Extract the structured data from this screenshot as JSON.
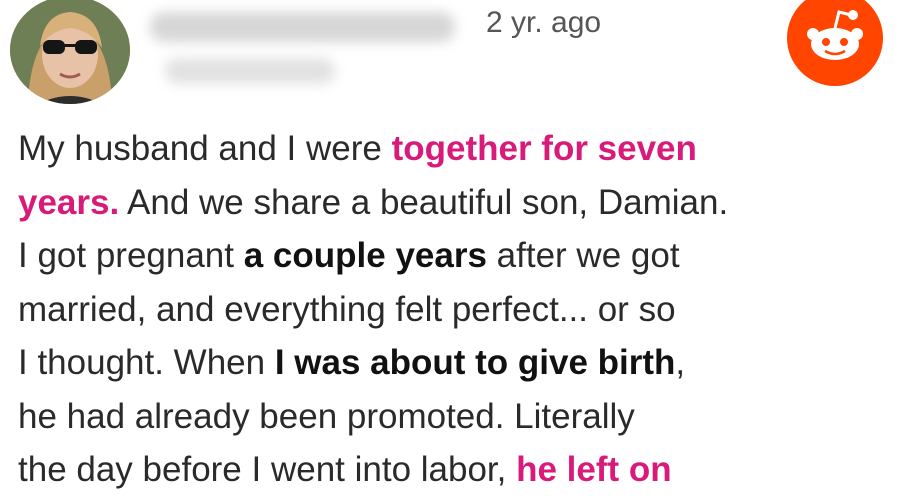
{
  "post": {
    "timestamp": "2 yr. ago",
    "lines": [
      [
        {
          "t": "My husband and I were ",
          "s": "n"
        },
        {
          "t": "together for seven",
          "s": "hl"
        }
      ],
      [
        {
          "t": "years.",
          "s": "hl"
        },
        {
          "t": " And we share a beautiful son, Damian.",
          "s": "n"
        }
      ],
      [
        {
          "t": "I got pregnant ",
          "s": "n"
        },
        {
          "t": "a couple years",
          "s": "b"
        },
        {
          "t": " after we got",
          "s": "n"
        }
      ],
      [
        {
          "t": "married, and everything felt perfect... or so",
          "s": "n"
        }
      ],
      [
        {
          "t": "I thought. When ",
          "s": "n"
        },
        {
          "t": "I was about to give birth",
          "s": "b"
        },
        {
          "t": ",",
          "s": "n"
        }
      ],
      [
        {
          "t": "he had already been promoted. Literally",
          "s": "n"
        }
      ],
      [
        {
          "t": "the day before I went into labor, ",
          "s": "n"
        },
        {
          "t": "he left on",
          "s": "hl"
        }
      ]
    ]
  },
  "icons": {
    "avatar": "user-avatar-photo",
    "logo": "reddit-logo-icon"
  },
  "colors": {
    "highlight": "#d81b7a",
    "reddit_orange": "#ff4500"
  }
}
